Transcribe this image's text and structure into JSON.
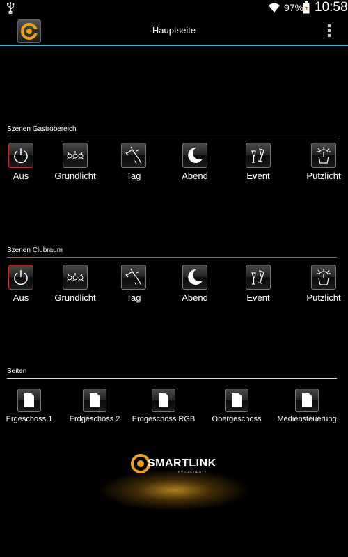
{
  "status_bar": {
    "battery_percent": "97%",
    "time": "10:58"
  },
  "action_bar": {
    "title": "Hauptseite"
  },
  "sections": [
    {
      "header": "Szenen Gastrobereich",
      "scenes": [
        {
          "label": "Aus",
          "icon": "power-icon",
          "active": true
        },
        {
          "label": "Grundlicht",
          "icon": "lights-icon"
        },
        {
          "label": "Tag",
          "icon": "daylight-icon"
        },
        {
          "label": "Abend",
          "icon": "moon-icon"
        },
        {
          "label": "Event",
          "icon": "glasses-icon"
        },
        {
          "label": "Putzlicht",
          "icon": "cleaning-icon"
        }
      ]
    },
    {
      "header": "Szenen Clubraum",
      "scenes": [
        {
          "label": "Aus",
          "icon": "power-icon",
          "active": true
        },
        {
          "label": "Grundlicht",
          "icon": "lights-icon"
        },
        {
          "label": "Tag",
          "icon": "daylight-icon"
        },
        {
          "label": "Abend",
          "icon": "moon-icon"
        },
        {
          "label": "Event",
          "icon": "glasses-icon"
        },
        {
          "label": "Putzlicht",
          "icon": "cleaning-icon"
        }
      ]
    }
  ],
  "pages": {
    "header": "Seiten",
    "items": [
      {
        "label": "Ergeschoss 1",
        "icon": "page-icon"
      },
      {
        "label": "Erdgeschoss 2",
        "icon": "page-icon"
      },
      {
        "label": "Erdgeschoss RGB",
        "icon": "page-icon"
      },
      {
        "label": "Obergeschoss",
        "icon": "page-icon"
      },
      {
        "label": "Mediensteuerung",
        "icon": "page-icon"
      }
    ]
  },
  "brand": {
    "wordmark": "SMARTLINK",
    "byline": "BY GOLDENTY"
  },
  "colors": {
    "accent": "#33b5e5",
    "section_line": "#b23bd6",
    "brand": "#e8a317",
    "active_border": "#d8241c"
  }
}
